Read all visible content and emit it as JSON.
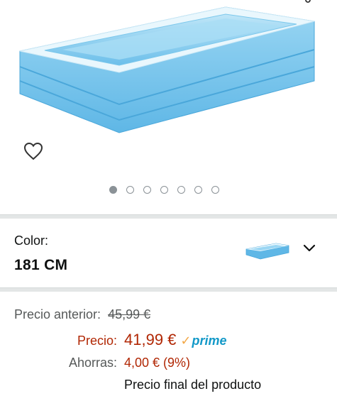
{
  "gallery": {
    "image_count": 7,
    "active_index": 0
  },
  "color_selector": {
    "label": "Color:",
    "value": "181 CM"
  },
  "pricing": {
    "previous_label": "Precio anterior:",
    "previous_value": "45,99 €",
    "price_label": "Precio:",
    "price_value": "41,99 €",
    "prime_check": "✓",
    "prime_text": "prime",
    "savings_label": "Ahorras:",
    "savings_value": "4,00 € (9%)",
    "final_note": "Precio final del producto"
  },
  "colors": {
    "price_red": "#b12704",
    "prime_blue": "#1399c8",
    "prime_orange": "#f3a847",
    "pool_blue": "#7ec6ec"
  }
}
